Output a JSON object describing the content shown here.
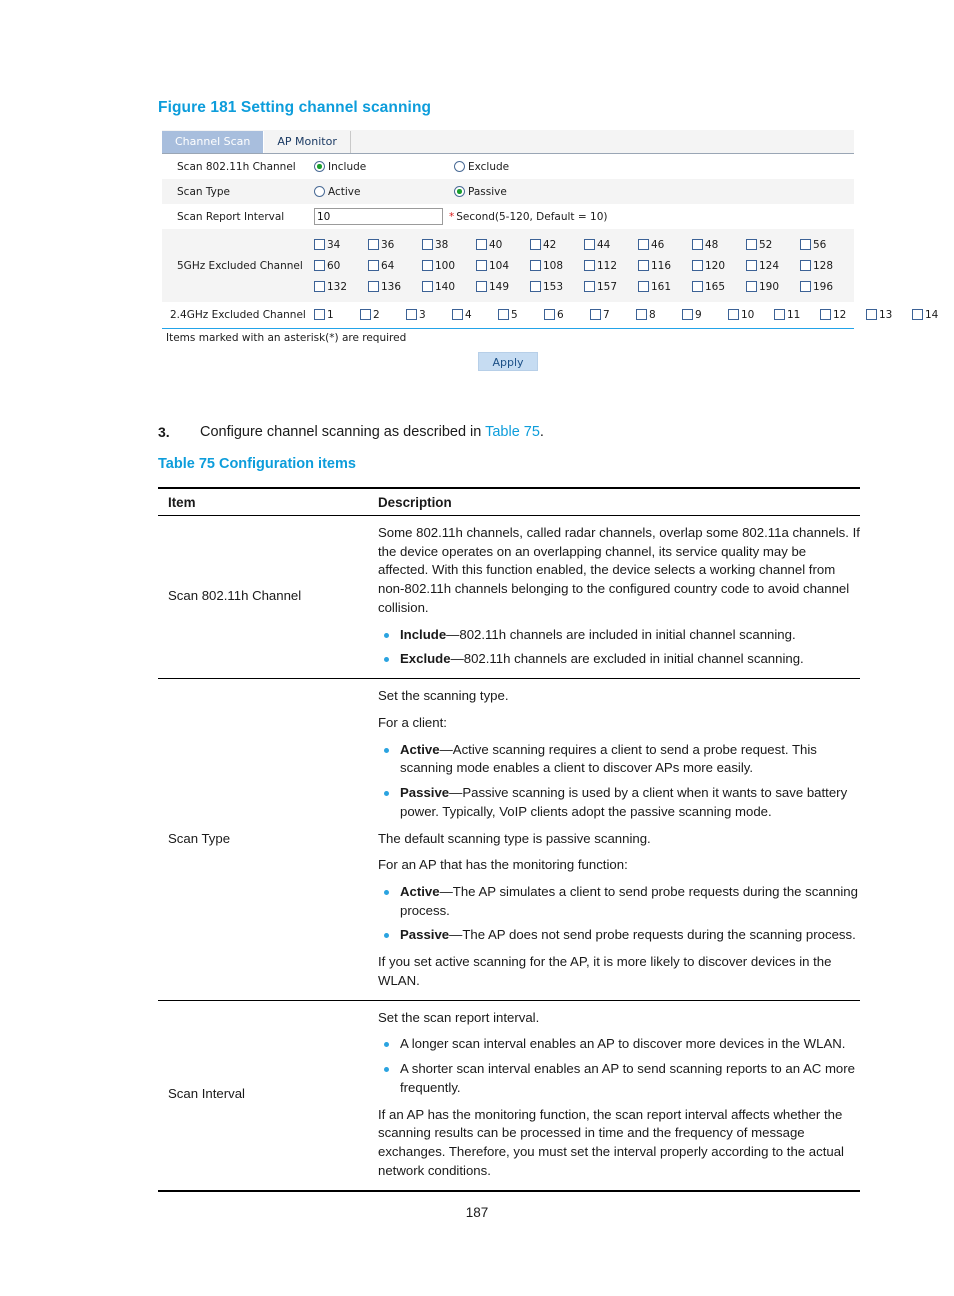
{
  "figure": {
    "caption": "Figure 181 Setting channel scanning",
    "tabs": [
      {
        "label": "Channel Scan",
        "active": true
      },
      {
        "label": "AP Monitor",
        "active": false
      }
    ],
    "fields": {
      "scan_11h_label": "Scan 802.11h Channel",
      "scan_11h_options": [
        {
          "label": "Include",
          "selected": true
        },
        {
          "label": "Exclude",
          "selected": false
        }
      ],
      "scan_type_label": "Scan Type",
      "scan_type_options": [
        {
          "label": "Active",
          "selected": false
        },
        {
          "label": "Passive",
          "selected": true
        }
      ],
      "scan_report_interval_label": "Scan Report Interval",
      "scan_report_interval_value": "10",
      "scan_report_interval_star": "*",
      "scan_report_interval_hint": "Second(5-120, Default = 10)",
      "excluded_5ghz_label": "5GHz Excluded Channel",
      "excluded_5ghz_rows": [
        [
          "34",
          "36",
          "38",
          "40",
          "42",
          "44",
          "46",
          "48",
          "52",
          "56"
        ],
        [
          "60",
          "64",
          "100",
          "104",
          "108",
          "112",
          "116",
          "120",
          "124",
          "128"
        ],
        [
          "132",
          "136",
          "140",
          "149",
          "153",
          "157",
          "161",
          "165",
          "190",
          "196"
        ]
      ],
      "excluded_24ghz_label": "2.4GHz Excluded Channel",
      "excluded_24ghz_row": [
        "1",
        "2",
        "3",
        "4",
        "5",
        "6",
        "7",
        "8",
        "9",
        "10",
        "11",
        "12",
        "13",
        "14"
      ]
    },
    "required_note": "Items marked with an asterisk(*) are required",
    "apply_label": "Apply",
    "colors": {
      "active_tab_bg": "#a8bedd",
      "row_shade": "#f4f4f4",
      "accent_blue": "#22a3e8",
      "apply_bg": "#c6dcf2",
      "radio_dot": "#1a9e2e",
      "required_star": "#d81818"
    }
  },
  "step": {
    "number": "3.",
    "text_before": "Configure channel scanning as described in ",
    "link": "Table 75",
    "text_after": "."
  },
  "table": {
    "caption": "Table 75 Configuration items",
    "headers": {
      "item": "Item",
      "description": "Description"
    },
    "rows": [
      {
        "item": "Scan 802.11h Channel",
        "paragraphs": [
          "Some 802.11h channels, called radar channels, overlap some 802.11a channels. If the device operates on an overlapping channel, its service quality may be affected. With this function enabled, the device selects a working channel from non-802.11h channels belonging to the configured country code to avoid channel collision."
        ],
        "bullets": [
          {
            "term": "Include",
            "rest": "—802.11h channels are included in initial channel scanning."
          },
          {
            "term": "Exclude",
            "rest": "—802.11h channels are excluded in initial channel scanning."
          }
        ]
      },
      {
        "item": "Scan Type",
        "intro": "Set the scanning type.",
        "client_heading": "For a client:",
        "client_bullets": [
          {
            "term": "Active",
            "rest": "—Active scanning requires a client to send a probe request. This scanning mode enables a client to discover APs more easily."
          },
          {
            "term": "Passive",
            "rest": "—Passive scanning is used by a client when it wants to save battery power. Typically, VoIP clients adopt the passive scanning mode."
          }
        ],
        "default_note": "The default scanning type is passive scanning.",
        "ap_heading": "For an AP that has the monitoring function:",
        "ap_bullets": [
          {
            "term": "Active",
            "rest": "—The AP simulates a client to send probe requests during the scanning process."
          },
          {
            "term": "Passive",
            "rest": "—The AP does not send probe requests during the scanning process."
          }
        ],
        "closing": "If you set active scanning for the AP, it is more likely to discover devices in the WLAN."
      },
      {
        "item": "Scan Interval",
        "intro": "Set the scan report interval.",
        "bullets": [
          {
            "term": "",
            "rest": "A longer scan interval enables an AP to discover more devices in the WLAN."
          },
          {
            "term": "",
            "rest": "A shorter scan interval enables an AP to send scanning reports to an AC more frequently."
          }
        ],
        "closing": "If an AP has the monitoring function, the scan report interval affects whether the scanning results can be processed in time and the frequency of message exchanges. Therefore, you must set the interval properly according to the actual network conditions."
      }
    ]
  },
  "footer": {
    "page_number": "187"
  }
}
